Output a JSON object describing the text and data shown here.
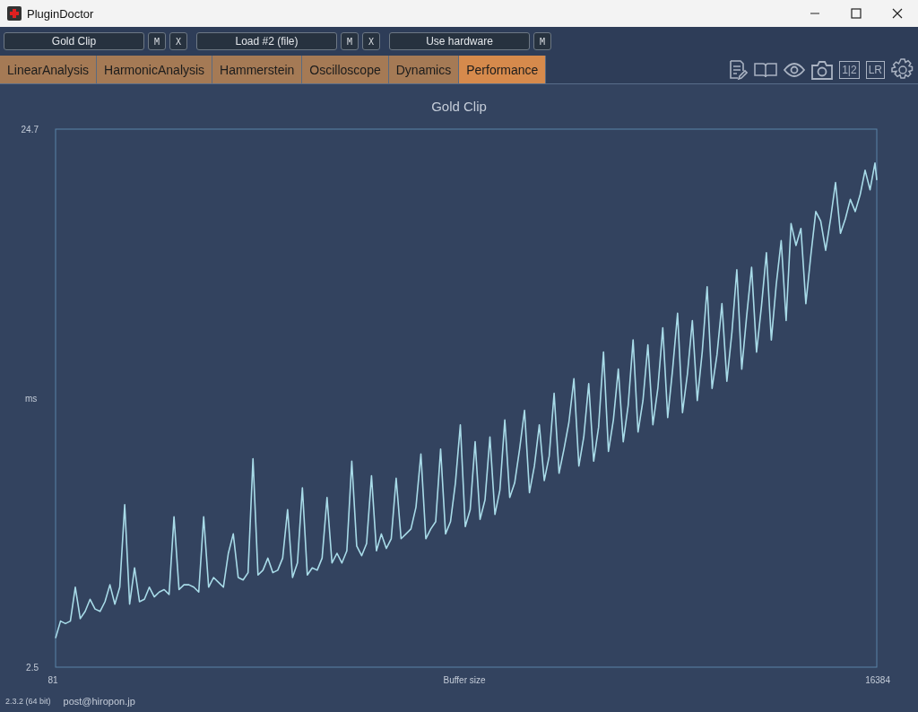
{
  "window": {
    "title": "PluginDoctor"
  },
  "plugin_slots": [
    {
      "label": "Gold Clip",
      "buttons": [
        "M",
        "X"
      ]
    },
    {
      "label": "Load #2 (file)",
      "buttons": [
        "M",
        "X"
      ]
    },
    {
      "label": "Use hardware",
      "buttons": [
        "M"
      ]
    }
  ],
  "tabs": [
    {
      "label": "LinearAnalysis",
      "selected": false
    },
    {
      "label": "HarmonicAnalysis",
      "selected": false
    },
    {
      "label": "Hammerstein",
      "selected": false
    },
    {
      "label": "Oscilloscope",
      "selected": false
    },
    {
      "label": "Dynamics",
      "selected": false
    },
    {
      "label": "Performance",
      "selected": true
    }
  ],
  "tools": [
    {
      "kind": "notes"
    },
    {
      "kind": "book"
    },
    {
      "kind": "eye"
    },
    {
      "kind": "camera"
    },
    {
      "kind": "text",
      "label": "1|2"
    },
    {
      "kind": "text",
      "label": "LR"
    },
    {
      "kind": "gear"
    }
  ],
  "chart": {
    "chart_data": {
      "type": "line",
      "title": "Gold Clip",
      "xlabel": "Buffer size",
      "ylabel": "ms",
      "xlim": [
        81,
        16384
      ],
      "ylim": [
        2.5,
        24.7
      ],
      "xticks": [
        81,
        16384
      ],
      "yticks": [
        2.5,
        24.7
      ],
      "x": [
        81,
        179,
        277,
        375,
        473,
        571,
        669,
        767,
        865,
        963,
        1061,
        1159,
        1257,
        1355,
        1453,
        1551,
        1649,
        1747,
        1845,
        1943,
        2041,
        2139,
        2237,
        2335,
        2433,
        2531,
        2629,
        2727,
        2825,
        2923,
        3021,
        3119,
        3217,
        3315,
        3413,
        3511,
        3609,
        3707,
        3805,
        3903,
        4001,
        4099,
        4197,
        4295,
        4393,
        4491,
        4589,
        4687,
        4785,
        4883,
        4981,
        5079,
        5177,
        5275,
        5373,
        5471,
        5569,
        5667,
        5765,
        5863,
        5961,
        6059,
        6157,
        6255,
        6353,
        6451,
        6549,
        6647,
        6745,
        6843,
        6941,
        7039,
        7137,
        7235,
        7333,
        7431,
        7529,
        7627,
        7725,
        7823,
        7921,
        8019,
        8117,
        8215,
        8313,
        8411,
        8509,
        8607,
        8705,
        8803,
        8901,
        8999,
        9097,
        9195,
        9293,
        9391,
        9489,
        9587,
        9685,
        9783,
        9881,
        9979,
        10077,
        10175,
        10273,
        10371,
        10469,
        10567,
        10665,
        10763,
        10861,
        10959,
        11057,
        11155,
        11253,
        11351,
        11449,
        11547,
        11645,
        11743,
        11841,
        11939,
        12037,
        12135,
        12233,
        12331,
        12429,
        12527,
        12625,
        12723,
        12821,
        12919,
        13017,
        13115,
        13213,
        13311,
        13409,
        13507,
        13605,
        13703,
        13801,
        13899,
        13997,
        14095,
        14193,
        14291,
        14389,
        14487,
        14585,
        14683,
        14781,
        14879,
        14977,
        15075,
        15173,
        15271,
        15369,
        15467,
        15565,
        15663,
        15761,
        15859,
        15957,
        16055,
        16153,
        16251,
        16349,
        16384
      ],
      "series": [
        {
          "color": "#a8dbe8",
          "values": [
            3.7,
            4.4,
            4.3,
            4.4,
            5.8,
            4.5,
            4.8,
            5.3,
            4.9,
            4.8,
            5.2,
            5.9,
            5.1,
            5.8,
            9.2,
            5.1,
            6.6,
            5.2,
            5.3,
            5.8,
            5.4,
            5.6,
            5.7,
            5.5,
            8.7,
            5.7,
            5.9,
            5.9,
            5.8,
            5.6,
            8.7,
            5.8,
            6.2,
            6.0,
            5.8,
            7.2,
            8.0,
            6.2,
            6.1,
            6.4,
            11.1,
            6.3,
            6.5,
            7.0,
            6.4,
            6.5,
            7.0,
            9.0,
            6.2,
            6.8,
            9.9,
            6.3,
            6.6,
            6.5,
            7.0,
            9.5,
            6.8,
            7.2,
            6.8,
            7.3,
            11.0,
            7.5,
            7.1,
            7.6,
            10.4,
            7.3,
            8.0,
            7.4,
            7.8,
            10.3,
            7.8,
            8.0,
            8.2,
            9.1,
            11.3,
            7.8,
            8.2,
            8.5,
            11.5,
            8.0,
            8.5,
            10.1,
            12.5,
            8.3,
            9.0,
            11.8,
            8.6,
            9.4,
            12.0,
            8.8,
            9.8,
            12.7,
            9.5,
            10.1,
            11.5,
            13.1,
            9.7,
            10.8,
            12.5,
            10.2,
            11.2,
            13.8,
            10.5,
            11.5,
            12.6,
            14.4,
            10.8,
            12.0,
            14.2,
            11.0,
            12.4,
            15.5,
            11.4,
            12.7,
            14.8,
            11.8,
            13.3,
            16.0,
            12.2,
            13.5,
            15.8,
            12.5,
            14.0,
            16.5,
            12.8,
            14.8,
            17.1,
            13.0,
            14.6,
            16.8,
            13.5,
            15.5,
            18.2,
            14.0,
            15.4,
            17.5,
            14.3,
            16.3,
            18.9,
            14.8,
            17.0,
            19.0,
            15.5,
            17.4,
            19.6,
            16.0,
            18.3,
            20.1,
            16.8,
            20.8,
            19.9,
            20.6,
            17.5,
            19.5,
            21.3,
            20.9,
            19.7,
            21.0,
            22.5,
            20.4,
            21.0,
            21.8,
            21.3,
            22.0,
            23.0,
            22.2,
            23.3,
            22.6
          ]
        }
      ]
    }
  },
  "status_bar": {
    "version": "2.3.2 (64 bit)",
    "email": "post@hiropon.jp"
  }
}
